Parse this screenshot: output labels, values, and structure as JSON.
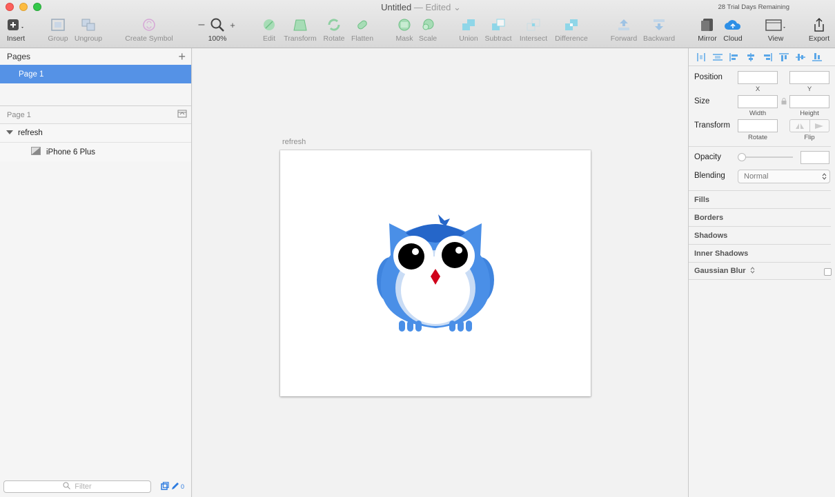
{
  "window": {
    "title": "Untitled",
    "edited": "— Edited",
    "trial": "28 Trial Days Remaining"
  },
  "toolbar": {
    "insert": "Insert",
    "group": "Group",
    "ungroup": "Ungroup",
    "create_symbol": "Create Symbol",
    "zoom_minus": "–",
    "zoom": "100%",
    "zoom_plus": "+",
    "edit": "Edit",
    "transform": "Transform",
    "rotate": "Rotate",
    "flatten": "Flatten",
    "mask": "Mask",
    "scale": "Scale",
    "union": "Union",
    "subtract": "Subtract",
    "intersect": "Intersect",
    "difference": "Difference",
    "forward": "Forward",
    "backward": "Backward",
    "mirror": "Mirror",
    "cloud": "Cloud",
    "view": "View",
    "export": "Export"
  },
  "pages": {
    "header": "Pages",
    "add": "+",
    "items": [
      "Page 1"
    ]
  },
  "layers": {
    "header": "Page 1",
    "group": "refresh",
    "child": "iPhone 6 Plus"
  },
  "filter": {
    "placeholder": "Filter",
    "count": "0"
  },
  "canvas": {
    "artboard_name": "refresh"
  },
  "inspector": {
    "position": "Position",
    "x": "X",
    "y": "Y",
    "size": "Size",
    "width": "Width",
    "height": "Height",
    "transform": "Transform",
    "rotate": "Rotate",
    "flip": "Flip",
    "opacity": "Opacity",
    "blending": "Blending",
    "blending_value": "Normal",
    "sections": [
      "Fills",
      "Borders",
      "Shadows",
      "Inner Shadows",
      "Gaussian Blur"
    ]
  },
  "colors": {
    "selection": "#5592e6",
    "owl_blue": "#4a8fe7",
    "owl_dark": "#2566c9",
    "beak": "#d0021b"
  }
}
